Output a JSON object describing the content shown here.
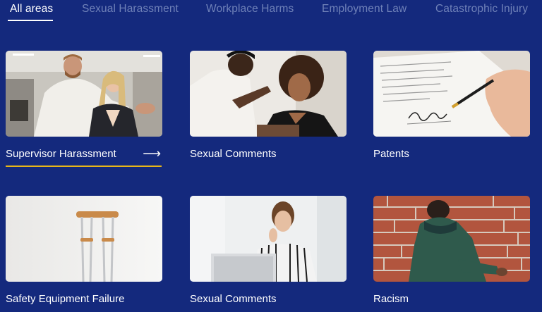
{
  "tabs": [
    {
      "label": "All areas",
      "active": true
    },
    {
      "label": "Sexual Harassment",
      "active": false
    },
    {
      "label": "Workplace Harms",
      "active": false
    },
    {
      "label": "Employment Law",
      "active": false
    },
    {
      "label": "Catastrophic Injury",
      "active": false
    }
  ],
  "cards": [
    {
      "label": "Supervisor Harassment",
      "arrow": "⟶",
      "selected": true
    },
    {
      "label": "Sexual Comments"
    },
    {
      "label": "Patents"
    },
    {
      "label": "Safety Equipment Failure"
    },
    {
      "label": "Sexual Comments"
    },
    {
      "label": "Racism"
    }
  ],
  "colors": {
    "background": "#14297d",
    "active_tab": "#ffffff",
    "inactive_tab": "#6f81b8",
    "accent_underline": "#e8b618"
  }
}
